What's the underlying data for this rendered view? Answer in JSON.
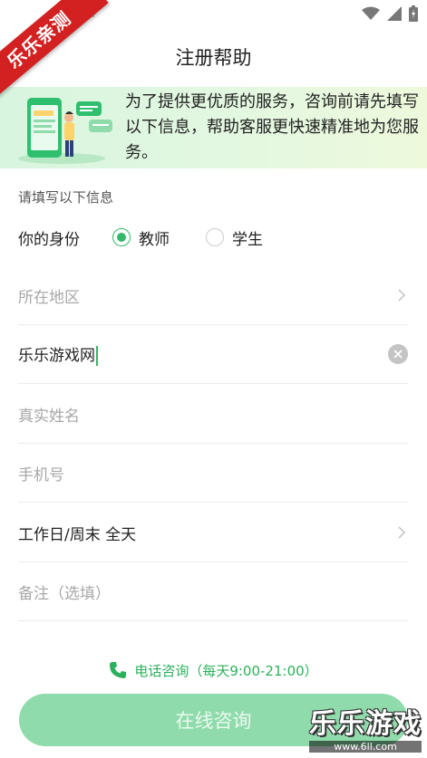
{
  "watermark": {
    "corner_ribbon": "乐乐亲测",
    "brand": "乐乐游戏",
    "url": "www.6ll.com"
  },
  "header": {
    "title": "注册帮助"
  },
  "banner": {
    "text": "为了提供更优质的服务，咨询前请先填写以下信息，帮助客服更快速精准地为您服务。"
  },
  "form": {
    "section_hint": "请填写以下信息",
    "identity": {
      "label": "你的身份",
      "options": [
        {
          "label": "教师",
          "selected": true
        },
        {
          "label": "学生",
          "selected": false
        }
      ]
    },
    "region": {
      "placeholder": "所在地区",
      "value": ""
    },
    "organization": {
      "value": "乐乐游戏网"
    },
    "real_name": {
      "placeholder": "真实姓名",
      "value": ""
    },
    "phone": {
      "placeholder": "手机号",
      "value": ""
    },
    "contact_time": {
      "value": "工作日/周末 全天"
    },
    "remark": {
      "placeholder": "备注（选填）",
      "value": ""
    }
  },
  "footer": {
    "phone_consult": "电话咨询（每天9:00-21:00）",
    "online_button": "在线咨询"
  },
  "colors": {
    "accent": "#35b86a",
    "phone_text": "#2bb05b",
    "button_bg": "#8fdbab",
    "banner_bg": "#d8f5df",
    "placeholder": "#a8a8a8"
  },
  "icons": {
    "status": [
      "wifi-icon",
      "signal-icon",
      "battery-icon"
    ],
    "phone": "phone-icon",
    "region_arrow": "chevron-right-icon",
    "time_arrow": "chevron-right-icon",
    "clear": "clear-icon"
  }
}
